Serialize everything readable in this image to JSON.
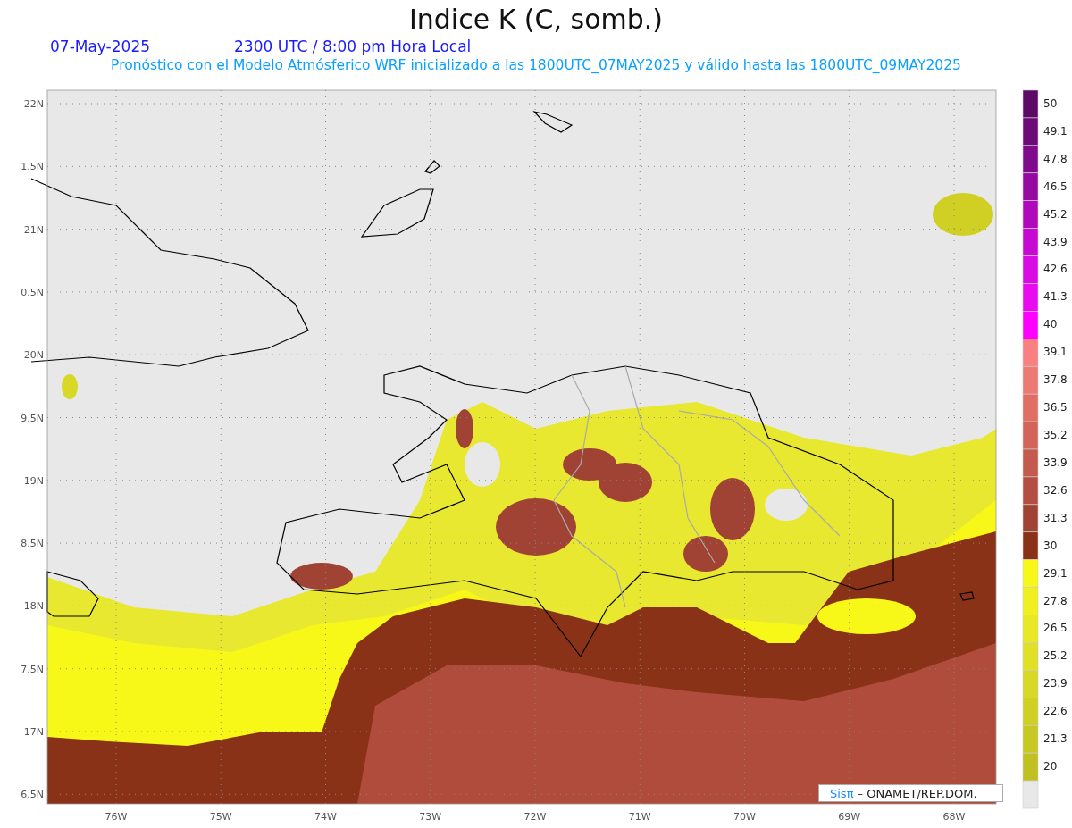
{
  "title": "Indice K (C, somb.)",
  "date": "07-May-2025",
  "time": "2300 UTC / 8:00 pm Hora Local",
  "subtitle": "Pronóstico con el Modelo Atmósferico WRF inicializado a las 1800UTC_07MAY2025 y válido hasta las  1800UTC_09MAY2025",
  "map": {
    "y_labels": [
      "22N",
      "1.5N",
      "21N",
      "0.5N",
      "20N",
      "9.5N",
      "19N",
      "8.5N",
      "18N",
      "7.5N",
      "17N",
      "6.5N"
    ],
    "x_labels": [
      "76W",
      "75W",
      "74W",
      "73W",
      "72W",
      "71W",
      "70W",
      "69W",
      "68W"
    ]
  },
  "colorbar": [
    {
      "color": "#5c0a66",
      "label": "50"
    },
    {
      "color": "#6c0a78",
      "label": "49.1"
    },
    {
      "color": "#800a8c",
      "label": "47.8"
    },
    {
      "color": "#960aa2",
      "label": "46.5"
    },
    {
      "color": "#ae0abc",
      "label": "45.2"
    },
    {
      "color": "#c60ad2",
      "label": "43.9"
    },
    {
      "color": "#da0ae4",
      "label": "42.6"
    },
    {
      "color": "#ea0af0",
      "label": "41.3"
    },
    {
      "color": "#ff00ff",
      "label": "40"
    },
    {
      "color": "#f88080",
      "label": "39.1"
    },
    {
      "color": "#ec7a72",
      "label": "37.8"
    },
    {
      "color": "#e06e64",
      "label": "36.5"
    },
    {
      "color": "#d2645a",
      "label": "35.2"
    },
    {
      "color": "#c45a4e",
      "label": "33.9"
    },
    {
      "color": "#b44e42",
      "label": "32.6"
    },
    {
      "color": "#a04234",
      "label": "31.3"
    },
    {
      "color": "#8a3218",
      "label": "30"
    },
    {
      "color": "#f8f818",
      "label": "29.1"
    },
    {
      "color": "#f0f020",
      "label": "27.8"
    },
    {
      "color": "#e8e824",
      "label": "26.5"
    },
    {
      "color": "#e0e026",
      "label": "25.2"
    },
    {
      "color": "#d8d826",
      "label": "23.9"
    },
    {
      "color": "#d0d024",
      "label": "22.6"
    },
    {
      "color": "#c8c822",
      "label": "21.3"
    },
    {
      "color": "#c0c020",
      "label": "20"
    },
    {
      "color": "#e8e8e8"
    }
  ],
  "credit": {
    "brand": "Sisπ",
    "text": " – ONAMET/REP.DOM."
  }
}
